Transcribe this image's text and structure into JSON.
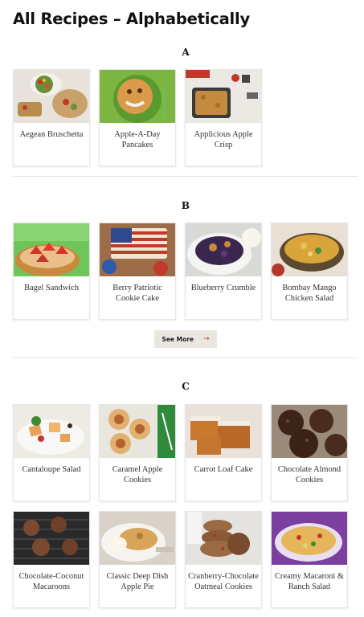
{
  "page": {
    "title": "All Recipes – Alphabetically"
  },
  "sections": [
    {
      "letter": "A",
      "recipes": [
        {
          "name": "Aegean Bruschetta"
        },
        {
          "name": "Apple-A-Day Pancakes"
        },
        {
          "name": "Applicious Apple Crisp"
        }
      ]
    },
    {
      "letter": "B",
      "recipes": [
        {
          "name": "Bagel Sandwich"
        },
        {
          "name": "Berry Patriotic Cookie Cake"
        },
        {
          "name": "Blueberry Crumble"
        },
        {
          "name": "Bombay Mango Chicken Salad"
        }
      ],
      "see_more": "See More",
      "see_more_arrow": "→"
    },
    {
      "letter": "C",
      "recipes": [
        {
          "name": "Cantaloupe Salad"
        },
        {
          "name": "Caramel Apple Cookies"
        },
        {
          "name": "Carrot Loaf Cake"
        },
        {
          "name": "Chocolate Almond Cookies"
        },
        {
          "name": "Chocolate-Coconut Macaroons"
        },
        {
          "name": "Classic Deep Dish Apple Pie"
        },
        {
          "name": "Cranberry-Chocolate Oatmeal Cookies"
        },
        {
          "name": "Creamy Macaroni & Ranch Salad"
        }
      ]
    }
  ]
}
